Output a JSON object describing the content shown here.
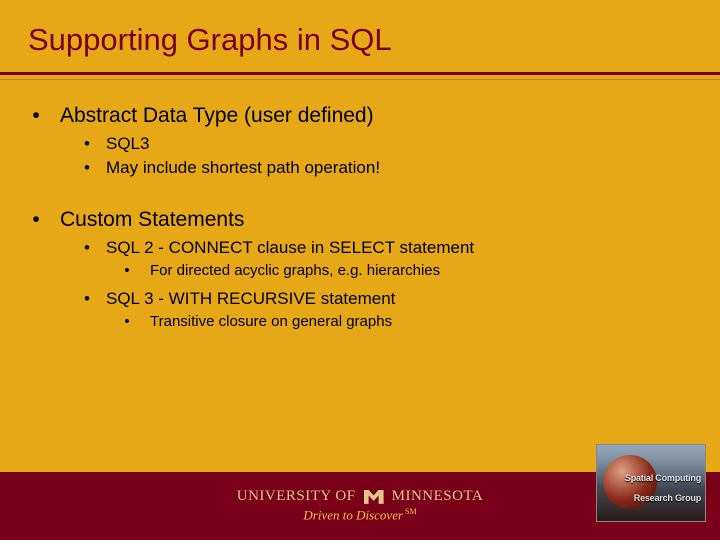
{
  "title": "Supporting Graphs in SQL",
  "sections": [
    {
      "text": "Abstract Data Type (user defined)",
      "sub": [
        {
          "text": "SQL3"
        },
        {
          "text": "May include shortest path operation!"
        }
      ]
    },
    {
      "text": "Custom Statements",
      "sub": [
        {
          "text": "SQL 2 - CONNECT clause in SELECT statement",
          "sub": [
            {
              "text": "For directed acyclic graphs, e.g. hierarchies"
            }
          ]
        },
        {
          "text": "SQL 3 - WITH RECURSIVE statement",
          "sub": [
            {
              "text": "Transitive closure on general graphs"
            }
          ]
        }
      ]
    }
  ],
  "footer": {
    "org_prefix": "UNIVERSITY OF",
    "org_name": "MINNESOTA",
    "tagline": "Driven to Discover",
    "mark": "SM"
  },
  "badge": {
    "line1": "Spatial Computing",
    "line2": "Research Group"
  }
}
